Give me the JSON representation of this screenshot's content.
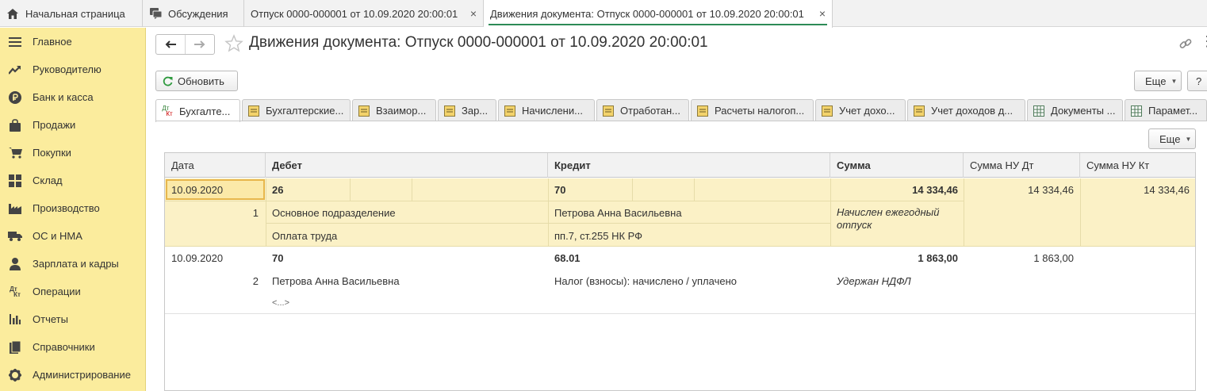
{
  "tabs": [
    {
      "label": "Начальная страница",
      "icon": "home-icon"
    },
    {
      "label": "Обсуждения",
      "icon": "chat-icon"
    },
    {
      "label": "Отпуск 0000-000001 от 10.09.2020 20:00:01",
      "icon": ""
    },
    {
      "label": "Движения документа: Отпуск 0000-000001 от 10.09.2020 20:00:01",
      "icon": ""
    }
  ],
  "close_symbol": "×",
  "sidebar": {
    "items": [
      {
        "label": "Главное",
        "icon": "menu-icon"
      },
      {
        "label": "Руководителю",
        "icon": "trend-icon"
      },
      {
        "label": "Банк и касса",
        "icon": "ruble-icon"
      },
      {
        "label": "Продажи",
        "icon": "bag-icon"
      },
      {
        "label": "Покупки",
        "icon": "cart-icon"
      },
      {
        "label": "Склад",
        "icon": "warehouse-icon"
      },
      {
        "label": "Производство",
        "icon": "factory-icon"
      },
      {
        "label": "ОС и НМА",
        "icon": "truck-icon"
      },
      {
        "label": "Зарплата и кадры",
        "icon": "person-icon"
      },
      {
        "label": "Операции",
        "icon": "dt-kt-icon"
      },
      {
        "label": "Отчеты",
        "icon": "bar-chart-icon"
      },
      {
        "label": "Справочники",
        "icon": "books-icon"
      },
      {
        "label": "Администрирование",
        "icon": "gear-icon"
      }
    ]
  },
  "page": {
    "title": "Движения документа: Отпуск 0000-000001 от 10.09.2020 20:00:01",
    "refresh_label": "Обновить",
    "more_label": "Еще",
    "help_label": "?"
  },
  "doc_tabs": [
    {
      "label": "Бухгалте...",
      "icon": "dt-kt-icon"
    },
    {
      "label": "Бухгалтерские...",
      "icon": "register-icon"
    },
    {
      "label": "Взаимор...",
      "icon": "register-icon"
    },
    {
      "label": "Зар...",
      "icon": "register-icon"
    },
    {
      "label": "Начислени...",
      "icon": "register-icon"
    },
    {
      "label": "Отработан...",
      "icon": "register-icon"
    },
    {
      "label": "Расчеты налогоп...",
      "icon": "register-icon"
    },
    {
      "label": "Учет дохо...",
      "icon": "register-icon"
    },
    {
      "label": "Учет доходов д...",
      "icon": "register-icon"
    },
    {
      "label": "Документы ...",
      "icon": "table-icon"
    },
    {
      "label": "Парамет...",
      "icon": "table-icon"
    }
  ],
  "table": {
    "headers": [
      "Дата",
      "Дебет",
      "Кредит",
      "Сумма",
      "Сумма НУ Дт",
      "Сумма НУ Кт"
    ],
    "rows": [
      {
        "date": "10.09.2020",
        "num": "1",
        "debit": "26",
        "debit_sub1": "Основное подразделение",
        "debit_sub2": "Оплата труда",
        "credit": "70",
        "credit_sub1": "Петрова Анна Васильевна",
        "credit_sub2": "пп.7, ст.255 НК РФ",
        "sum": "14 334,46",
        "content": "Начислен ежегодный отпуск",
        "nu_dt": "14 334,46",
        "nu_kt": "14 334,46"
      },
      {
        "date": "10.09.2020",
        "num": "2",
        "debit": "70",
        "debit_sub1": "Петрова Анна Васильевна",
        "debit_sub2": "<...>",
        "credit": "68.01",
        "credit_sub1": "Налог (взносы): начислено / уплачено",
        "sum": "1 863,00",
        "content": "Удержан НДФЛ",
        "nu_dt": "1 863,00",
        "nu_kt": ""
      }
    ]
  }
}
